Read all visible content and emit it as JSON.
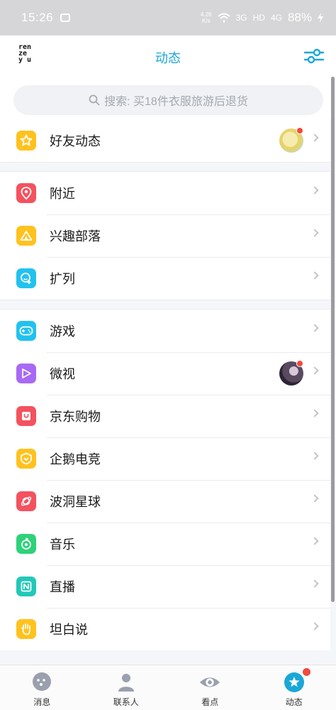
{
  "status_bar": {
    "time": "15:26",
    "speed_top": "4.26",
    "speed_bottom": "K/s",
    "net1": "3G",
    "net2": "HD",
    "net3": "4G",
    "battery": "88%"
  },
  "header": {
    "logo_lines": [
      "ren",
      "ze",
      "y u"
    ],
    "title": "动态"
  },
  "search": {
    "placeholder": "搜索: 买18件衣服旅游后退货"
  },
  "groups": [
    {
      "items": [
        {
          "label": "好友动态",
          "icon": "star-icon",
          "color": "#ffc21e",
          "has_avatar": true
        }
      ]
    },
    {
      "items": [
        {
          "label": "附近",
          "icon": "location-pin-icon",
          "color": "#f4525f"
        },
        {
          "label": "兴趣部落",
          "icon": "tent-icon",
          "color": "#ffc21e"
        },
        {
          "label": "扩列",
          "icon": "smile-add-icon",
          "color": "#21c2ef"
        }
      ]
    },
    {
      "items": [
        {
          "label": "游戏",
          "icon": "gamepad-icon",
          "color": "#21c2ef"
        },
        {
          "label": "微视",
          "icon": "play-icon",
          "color": "#a86af4",
          "has_avatar": true
        },
        {
          "label": "京东购物",
          "icon": "shopping-bag-icon",
          "color": "#f4525f"
        },
        {
          "label": "企鹅电竞",
          "icon": "esports-shield-icon",
          "color": "#ffc21e"
        },
        {
          "label": "波洞星球",
          "icon": "planet-icon",
          "color": "#f4525f"
        },
        {
          "label": "音乐",
          "icon": "music-icon",
          "color": "#2ed27a"
        },
        {
          "label": "直播",
          "icon": "live-icon",
          "color": "#22c8b8"
        },
        {
          "label": "坦白说",
          "icon": "hand-icon",
          "color": "#ffc21e"
        }
      ]
    }
  ],
  "tabs": [
    {
      "label": "消息",
      "icon": "message-icon"
    },
    {
      "label": "联系人",
      "icon": "contacts-icon"
    },
    {
      "label": "看点",
      "icon": "eye-icon"
    },
    {
      "label": "动态",
      "icon": "star-icon",
      "active": true
    }
  ],
  "colors": {
    "accent": "#1aa7d8",
    "badge": "#f04b3c"
  }
}
